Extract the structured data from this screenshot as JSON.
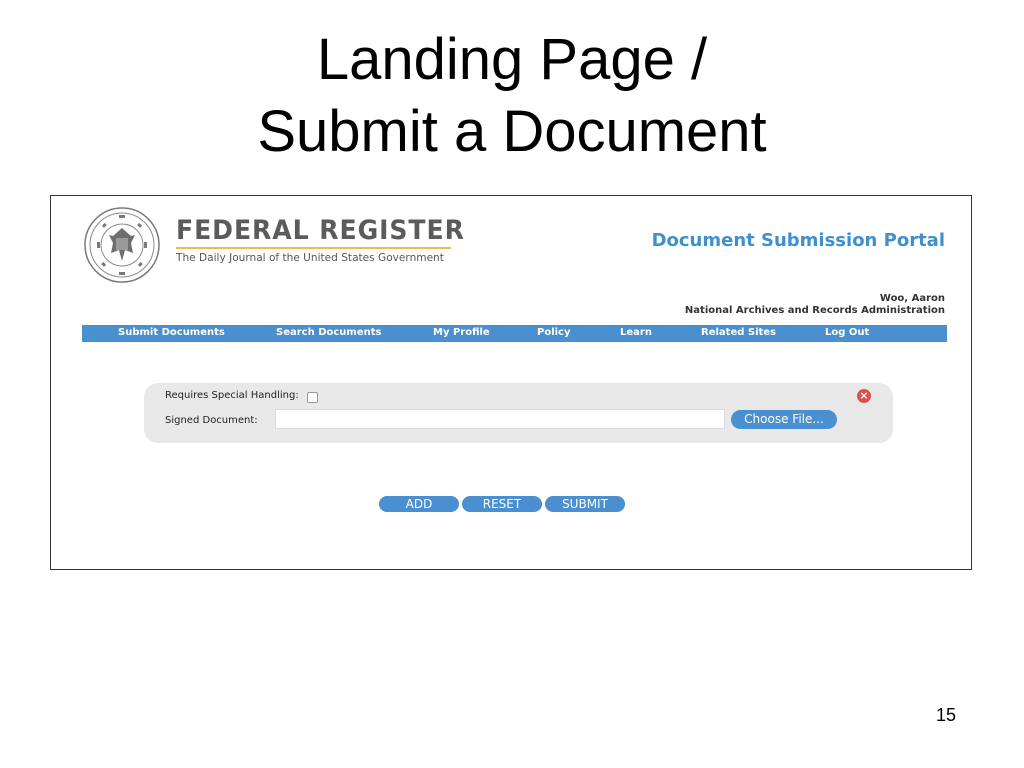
{
  "slide": {
    "title_line1": "Landing Page /",
    "title_line2": "Submit a Document",
    "page_number": "15"
  },
  "header": {
    "brand_name": "FEDERAL REGISTER",
    "brand_tagline": "The Daily Journal of the United States Government",
    "seal_icon": "nara-seal-icon",
    "portal_title": "Document Submission Portal",
    "user_name": "Woo, Aaron",
    "user_org": "National Archives and Records Administration"
  },
  "nav": {
    "items": [
      {
        "label": "Submit Documents"
      },
      {
        "label": "Search Documents"
      },
      {
        "label": "My Profile"
      },
      {
        "label": "Policy"
      },
      {
        "label": "Learn"
      },
      {
        "label": "Related Sites"
      },
      {
        "label": "Log Out"
      }
    ]
  },
  "form": {
    "special_handling_label": "Requires Special Handling:",
    "special_handling_checked": false,
    "signed_document_label": "Signed Document:",
    "signed_document_value": "",
    "choose_file_label": "Choose File...",
    "remove_icon": "close-circle-icon"
  },
  "actions": {
    "add_label": "ADD",
    "reset_label": "RESET",
    "submit_label": "SUBMIT"
  },
  "colors": {
    "accent_blue": "#4a90d0",
    "portal_title_blue": "#3f90cc",
    "brand_gold": "#e3c24a",
    "remove_red": "#d9534f"
  }
}
